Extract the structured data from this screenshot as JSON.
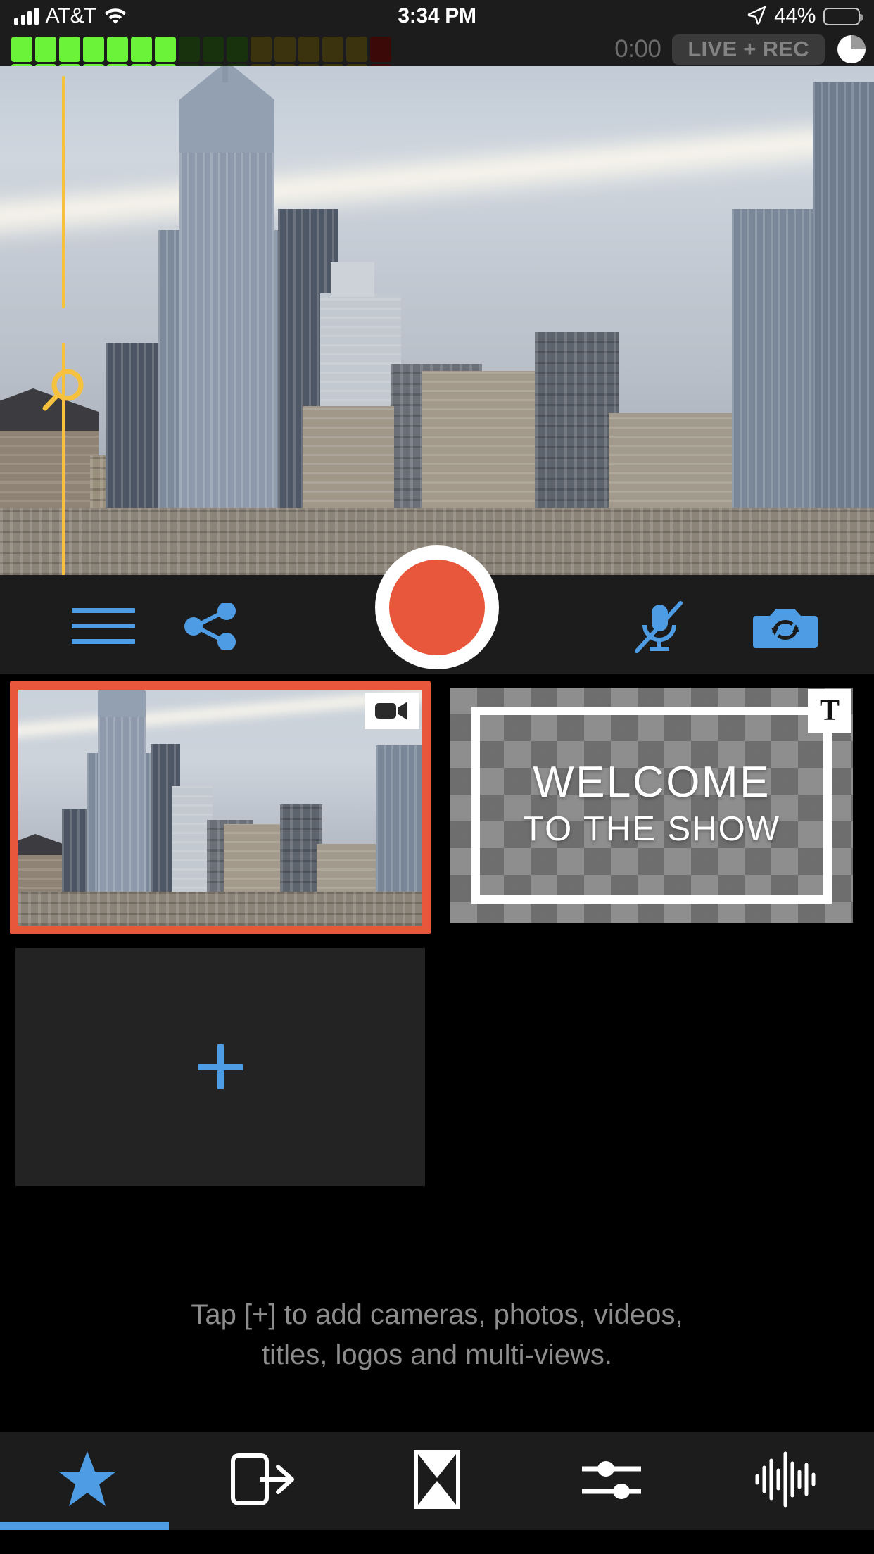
{
  "status_bar": {
    "carrier": "AT&T",
    "time": "3:34 PM",
    "battery_percent": "44%",
    "signal_icon": "cellular-signal-icon",
    "wifi_icon": "wifi-icon",
    "location_icon": "location-arrow-icon",
    "battery_icon": "battery-icon",
    "battery_fill_ratio": 0.44
  },
  "meter_bar": {
    "audio_meter_icon": "audio-level-meter",
    "segments": [
      "#6BF33A",
      "#6BF33A",
      "#6BF33A",
      "#6BF33A",
      "#6BF33A",
      "#6BF33A",
      "#6BF33A",
      "#18320D",
      "#18320D",
      "#18320D",
      "#3A330E",
      "#3A330E",
      "#3A330E",
      "#3A330E",
      "#3A330E",
      "#3B0A08"
    ],
    "timer": "0:00",
    "status_pill": "LIVE + REC",
    "disk_indicator_icon": "disk-space-pie-icon"
  },
  "preview": {
    "name": "camera-preview",
    "focus_slider_icon": "magnifier-focus-handle",
    "focus_color": "#F6C23E"
  },
  "controls": {
    "menu_icon": "hamburger-menu-icon",
    "share_icon": "share-icon",
    "record_button": "record-button",
    "record_color": "#E8563C",
    "mic_icon": "microphone-muted-icon",
    "camera_flip_icon": "camera-flip-icon",
    "accent_color": "#4E9DE4"
  },
  "sources": {
    "tiles": [
      {
        "type": "camera",
        "badge_icon": "video-camera-icon",
        "selected": true,
        "label": ""
      },
      {
        "type": "title",
        "badge_icon": "text-title-icon",
        "selected": false,
        "title_line1": "WELCOME",
        "title_line2": "TO THE SHOW"
      },
      {
        "type": "add",
        "badge_icon": "plus-icon",
        "selected": false,
        "label": ""
      }
    ],
    "hint_line1": "Tap [+] to add cameras, photos, videos,",
    "hint_line2": "titles, logos and multi-views."
  },
  "toolbar": {
    "items": [
      {
        "icon": "star-icon",
        "name": "tab-sources",
        "active": true
      },
      {
        "icon": "output-icon",
        "name": "tab-output",
        "active": false
      },
      {
        "icon": "transition-icon",
        "name": "tab-transitions",
        "active": false
      },
      {
        "icon": "sliders-icon",
        "name": "tab-settings",
        "active": false
      },
      {
        "icon": "waveform-icon",
        "name": "tab-audio",
        "active": false
      }
    ],
    "active_color": "#4E9DE4"
  }
}
